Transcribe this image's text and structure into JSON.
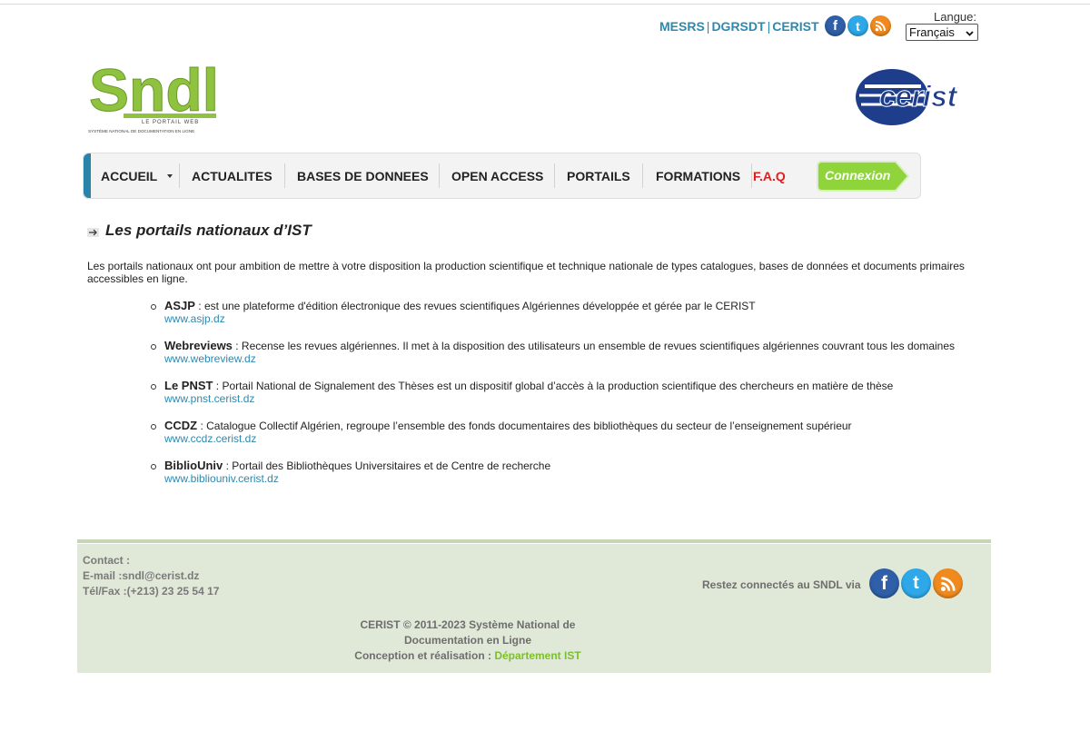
{
  "top_links": {
    "mesrs": "MESRS",
    "dgrsdt": "DGRSDT",
    "cerist": "CERIST",
    "separator": "|"
  },
  "language": {
    "label": "Langue:",
    "selected": "Français"
  },
  "logo_sndl": {
    "text": "Sndl",
    "subtitle1": "LE PORTAIL WEB",
    "subtitle2": "SYSTÈME NATIONAL DE DOCUMENTATION EN LIGNE"
  },
  "logo_cerist": {
    "text": "cerist"
  },
  "nav": {
    "items": [
      "ACCUEIL",
      "ACTUALITES",
      "BASES DE DONNEES",
      "OPEN ACCESS",
      "PORTAILS",
      "FORMATIONS",
      "F.A.Q"
    ],
    "connexion": "Connexion"
  },
  "section": {
    "title": "Les portails nationaux d’IST",
    "intro": "Les portails nationaux ont pour ambition de mettre à votre disposition la production scientifique et technique nationale de types catalogues, bases de données et documents primaires accessibles en ligne."
  },
  "portals": [
    {
      "name": "ASJP",
      "desc": " : est une plateforme d'édition électronique des revues scientifiques Algériennes développée et gérée par le CERIST",
      "url": "www.asjp.dz"
    },
    {
      "name": "Webreviews",
      "desc": " : Recense les revues algériennes. Il met à la disposition des utilisateurs un ensemble de revues scientifiques algériennes couvrant tous les domaines",
      "url": "www.webreview.dz"
    },
    {
      "name": "Le PNST",
      "desc": " : Portail National de Signalement des Thèses est un dispositif global d’accès à la production scientifique des chercheurs en matière de thèse",
      "url": "www.pnst.cerist.dz"
    },
    {
      "name": "CCDZ",
      "desc": " : Catalogue Collectif Algérien, regroupe l’ensemble des fonds documentaires des bibliothèques du secteur de l’enseignement supérieur",
      "url": "www.ccdz.cerist.dz"
    },
    {
      "name": "BiblioUniv",
      "desc": " : Portail des Bibliothèques Universitaires et de Centre de recherche",
      "url": "www.bibliouniv.cerist.dz"
    }
  ],
  "footer": {
    "contact_label": "Contact :",
    "email": "E-mail :sndl@cerist.dz",
    "phone": "Tél/Fax :(+213) 23 25 54 17",
    "restez": "Restez connectés au SNDL via",
    "copyright1": "CERIST © 2011-2023 Système National de Documentation en Ligne",
    "conception": "Conception et réalisation : ",
    "departement": "Département IST"
  },
  "icons": {
    "facebook": "facebook-icon",
    "twitter": "twitter-icon",
    "rss": "rss-icon"
  },
  "colors": {
    "link": "#2b89b2",
    "faq": "#e01d1d",
    "footer_bg": "#e0e8d7",
    "accent_green": "#7bbf2c"
  }
}
